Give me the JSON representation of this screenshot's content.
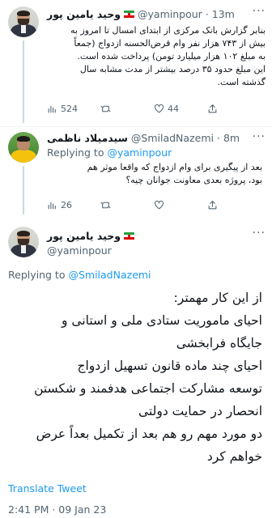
{
  "tweet1": {
    "display_name": "وحید یامین پور",
    "handle": "@yaminpour",
    "time": "13m",
    "lines": [
      "بنابر گزارش بانک مرکزی از ابتدای امسال تا امروز به",
      "بیش از ۷۴۳ هزار نفر وام قرض‌الحسنه ازدواج (جمعاً",
      "به مبلغ ۱۰۲ هزار میلیارد تومن) پرداخت شده است.",
      "این مبلغ حدود ۳۵ درصد بیشتر از مدت مشابه سال",
      "گذشته است."
    ],
    "replies": "",
    "retweets": "",
    "likes": "44",
    "views": "524"
  },
  "tweet2": {
    "display_name": "سیدمیلاد ناظمی",
    "handle": "@SmiladNazemi",
    "time": "8m",
    "replying_label": "Replying to",
    "replying_handle": "@yaminpour",
    "lines": [
      "بعد از پیگیری برای وام ازدواج که واقعا موثر هم",
      "بود، پروژه بعدی معاونت جوانان چیه؟"
    ],
    "views": "26"
  },
  "tweet3": {
    "display_name": "وحید یامین پور",
    "handle": "@yaminpour",
    "replying_label": "Replying to",
    "replying_handle": "@SmiladNazemi",
    "lines": [
      "از این کار مهمتر:",
      "احیای ماموریت ستادی ملی و استانی و",
      "جایگاه فرابخشی",
      "احیای چند ماده قانون تسهیل ازدواج",
      "توسعه مشارکت اجتماعی هدفمند و شکستن",
      "انحصار در حمایت دولتی",
      "دو مورد مهم رو هم بعد از تکمیل بعداً عرض",
      "خواهم کرد"
    ],
    "translate_label": "Translate Tweet",
    "timestamp": "2:41 PM · 09 Jan 23"
  },
  "more_glyph": "···",
  "colors": {
    "link": "#1d9bf0",
    "muted": "#536471",
    "text": "#0f1419"
  }
}
